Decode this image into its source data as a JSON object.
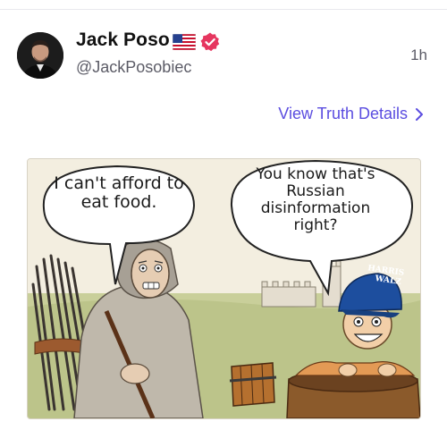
{
  "post": {
    "author_name": "Jack Poso",
    "handle": "@JackPosobiec",
    "timestamp": "1h",
    "view_details_label": "View Truth Details"
  },
  "icons": {
    "flag": "us-flag-icon",
    "verified": "verified-badge-icon",
    "chevron": "chevron-right-icon"
  },
  "colors": {
    "link": "#5b4de0",
    "verified": "#e6365f",
    "name": "#111111",
    "muted": "#5b5b66"
  },
  "comic": {
    "left_bubble": "I can't afford to eat food.",
    "right_bubble": "You know that's Russian disinformation right?",
    "hat_line_1": "HARRIS",
    "hat_line_2": "WALZ"
  }
}
